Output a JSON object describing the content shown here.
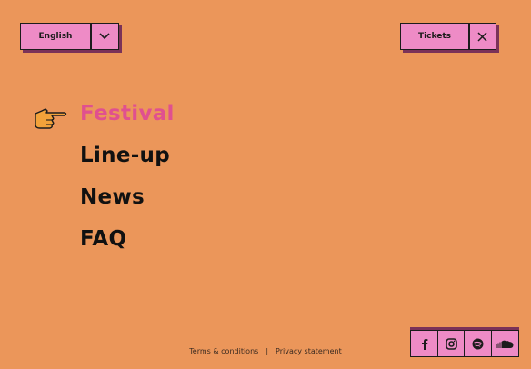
{
  "header": {
    "language_label": "English",
    "tickets_label": "Tickets"
  },
  "menu": {
    "items": [
      {
        "label": "Festival",
        "active": true
      },
      {
        "label": "Line-up"
      },
      {
        "label": "News"
      },
      {
        "label": "FAQ"
      }
    ]
  },
  "footer": {
    "terms_label": "Terms & conditions",
    "separator": "|",
    "privacy_label": "Privacy statement"
  },
  "social": {
    "icons": [
      "facebook-icon",
      "instagram-icon",
      "spotify-icon",
      "soundcloud-icon"
    ]
  },
  "colors": {
    "background": "#EB965A",
    "button_fill": "#EE8BC6",
    "active_menu": "#E0508F",
    "pointer_hand": "#F2A23A"
  }
}
